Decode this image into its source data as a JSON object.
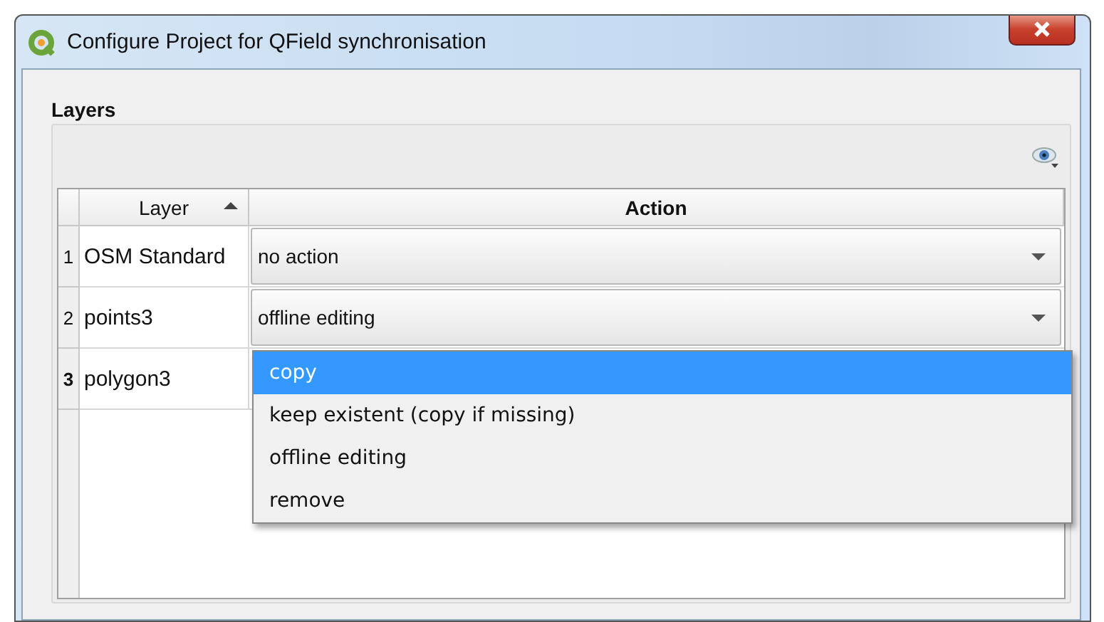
{
  "window": {
    "title": "Configure Project for QField synchronisation"
  },
  "section": {
    "title": "Layers"
  },
  "table": {
    "columns": [
      {
        "label": "Layer",
        "sorted_ascending": true,
        "current": false
      },
      {
        "label": "Action",
        "sorted_ascending": false,
        "current": true
      }
    ],
    "rows": [
      {
        "number": "1",
        "layer": "OSM Standard",
        "action": "no action",
        "current": false
      },
      {
        "number": "2",
        "layer": "points3",
        "action": "offline editing",
        "current": false
      },
      {
        "number": "3",
        "layer": "polygon3",
        "current": true
      }
    ]
  },
  "dropdown": {
    "items": [
      {
        "label": "copy",
        "selected": true
      },
      {
        "label": "keep existent (copy if missing)",
        "selected": false
      },
      {
        "label": "offline editing",
        "selected": false
      },
      {
        "label": "remove",
        "selected": false
      }
    ]
  }
}
